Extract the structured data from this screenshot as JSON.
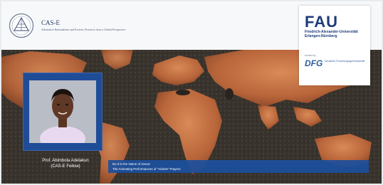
{
  "header": {
    "cas_title": "CAS-E",
    "cas_subtitle": "Alternative Rationalities and Esoteric Practices from a Global Perspective",
    "fau_logo": "FAU",
    "fau_name": "Friedrich-Alexander-Universität Erlangen-Nürnberg",
    "dfg_pre": "funded by",
    "dfg_logo": "DFG",
    "dfg_name": "Deutsche Forschungsgemeinschaft"
  },
  "speaker": {
    "name": "Prof. Abimbola Adelakun",
    "role": "(CAS-E Fellow)"
  },
  "talk": {
    "line1": "Do It in the Name of Jesus!",
    "line2": "The Animating Performances of \"Violent\" Prayers"
  },
  "icons": {
    "cas_logo": "cas-e-emblem-icon",
    "world_map": "world-map-background"
  },
  "colors": {
    "brand_blue": "#1e3c78",
    "banner_blue": "#1b4f9e",
    "map_orange": "#c06a3a"
  }
}
